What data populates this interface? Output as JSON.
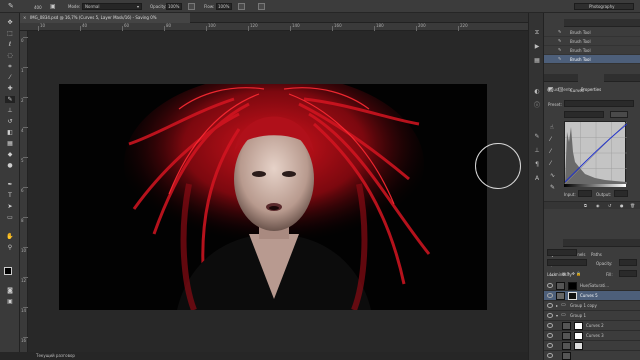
{
  "options_bar": {
    "brush_size": "400",
    "mode_label": "Mode:",
    "mode_value": "Normal",
    "opacity_label": "Opacity:",
    "opacity_value": "100%",
    "flow_label": "Flow:",
    "flow_value": "100%",
    "workspace": "Photography"
  },
  "document_tab": {
    "title": "IMG_0834.psd @ 16,7% (Curves 5, Layer Mask/16) - Saving 0%"
  },
  "ruler": {
    "h_labels": [
      "10",
      "40",
      "60",
      "80",
      "100",
      "120",
      "140",
      "160",
      "180",
      "200",
      "220"
    ],
    "v_labels": [
      "0",
      "1",
      "2",
      "4",
      "5",
      "6",
      "8",
      "10",
      "12",
      "14",
      "16"
    ]
  },
  "status_bar": {
    "text": "Текущий разговор"
  },
  "history_panel": {
    "tab_label": "History",
    "items": [
      "Brush Tool",
      "Brush Tool",
      "Brush Tool",
      "Brush Tool"
    ]
  },
  "properties_panel": {
    "tabs": [
      "Adjustments",
      "Properties"
    ],
    "header": "Curves",
    "preset_label": "Preset:",
    "preset_value": "Custom",
    "channel_value": "Blue",
    "auto_label": "Auto",
    "input_label": "Input:",
    "input_value": "252",
    "output_label": "Output:",
    "output_value": "255"
  },
  "layers_panel": {
    "tabs": [
      "Layers",
      "Channels",
      "Paths"
    ],
    "kind_label": "Kind",
    "blend_mode": "Luminosity",
    "opacity_label": "Opacity:",
    "opacity_value": "100%",
    "lock_label": "Lock:",
    "fill_label": "Fill:",
    "fill_value": "100%",
    "layers": [
      {
        "name": "Hue/Saturati..."
      },
      {
        "name": "Curves 5"
      },
      {
        "name": "Group 1 copy"
      },
      {
        "name": "Group 1"
      },
      {
        "name": "Curves 2"
      },
      {
        "name": "Curves 3"
      }
    ]
  },
  "colors": {
    "accent_selection": "#4d5f7a",
    "panel_bg": "#3c3c3c",
    "hair_red": "#d4101c"
  },
  "tool_icons": [
    "move-icon",
    "marquee-icon",
    "lasso-icon",
    "quick-select-icon",
    "crop-icon",
    "eyedropper-icon",
    "healing-icon",
    "brush-icon",
    "stamp-icon",
    "history-brush-icon",
    "eraser-icon",
    "gradient-icon",
    "blur-icon",
    "dodge-icon",
    "pen-icon",
    "type-icon",
    "path-select-icon",
    "shape-icon",
    "hand-icon",
    "zoom-icon"
  ]
}
